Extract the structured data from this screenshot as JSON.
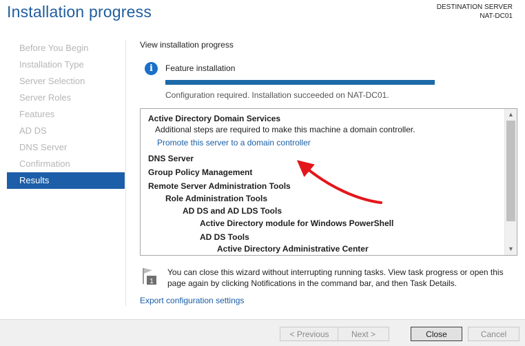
{
  "header": {
    "title": "Installation progress",
    "destination_label": "DESTINATION SERVER",
    "destination_server": "NAT-DC01"
  },
  "sidebar": {
    "items": [
      {
        "label": "Before You Begin",
        "active": false
      },
      {
        "label": "Installation Type",
        "active": false
      },
      {
        "label": "Server Selection",
        "active": false
      },
      {
        "label": "Server Roles",
        "active": false
      },
      {
        "label": "Features",
        "active": false
      },
      {
        "label": "AD DS",
        "active": false
      },
      {
        "label": "DNS Server",
        "active": false
      },
      {
        "label": "Confirmation",
        "active": false
      },
      {
        "label": "Results",
        "active": true
      }
    ]
  },
  "main": {
    "view_label": "View installation progress",
    "feature_label": "Feature installation",
    "progress_fraction": 1.0,
    "status_text": "Configuration required. Installation succeeded on NAT-DC01.",
    "results": [
      {
        "text": "Active Directory Domain Services",
        "style": "bold"
      },
      {
        "text": "Additional steps are required to make this machine a domain controller.",
        "style": "normal"
      },
      {
        "text": "Promote this server to a domain controller",
        "style": "link"
      },
      {
        "text": "DNS Server",
        "style": "bold"
      },
      {
        "text": "Group Policy Management",
        "style": "bold"
      },
      {
        "text": "Remote Server Administration Tools",
        "style": "bold"
      },
      {
        "text": "Role Administration Tools",
        "style": "bold"
      },
      {
        "text": "AD DS and AD LDS Tools",
        "style": "bold"
      },
      {
        "text": "Active Directory module for Windows PowerShell",
        "style": "bold"
      },
      {
        "text": "AD DS Tools",
        "style": "bold"
      },
      {
        "text": "Active Directory Administrative Center",
        "style": "bold"
      }
    ],
    "note_text": "You can close this wizard without interrupting running tasks. View task progress or open this page again by clicking Notifications in the command bar, and then Task Details.",
    "note_badge": "1",
    "export_link": "Export configuration settings"
  },
  "footer": {
    "previous": "< Previous",
    "next": "Next >",
    "close": "Close",
    "cancel": "Cancel"
  },
  "colors": {
    "accent": "#1c5ea8",
    "link": "#1a5ea4",
    "annotation_arrow": "#e3161b"
  }
}
